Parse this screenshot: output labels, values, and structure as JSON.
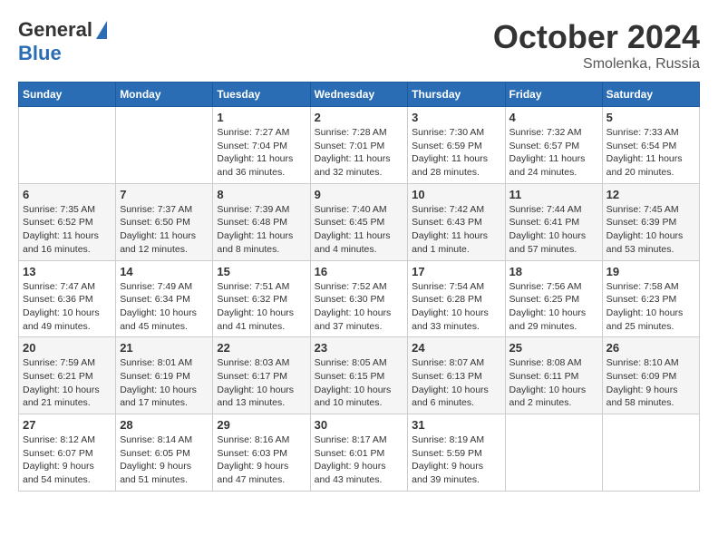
{
  "header": {
    "logo_general": "General",
    "logo_blue": "Blue",
    "month": "October 2024",
    "location": "Smolenka, Russia"
  },
  "weekdays": [
    "Sunday",
    "Monday",
    "Tuesday",
    "Wednesday",
    "Thursday",
    "Friday",
    "Saturday"
  ],
  "weeks": [
    [
      {
        "day": "",
        "info": ""
      },
      {
        "day": "",
        "info": ""
      },
      {
        "day": "1",
        "info": "Sunrise: 7:27 AM\nSunset: 7:04 PM\nDaylight: 11 hours and 36 minutes."
      },
      {
        "day": "2",
        "info": "Sunrise: 7:28 AM\nSunset: 7:01 PM\nDaylight: 11 hours and 32 minutes."
      },
      {
        "day": "3",
        "info": "Sunrise: 7:30 AM\nSunset: 6:59 PM\nDaylight: 11 hours and 28 minutes."
      },
      {
        "day": "4",
        "info": "Sunrise: 7:32 AM\nSunset: 6:57 PM\nDaylight: 11 hours and 24 minutes."
      },
      {
        "day": "5",
        "info": "Sunrise: 7:33 AM\nSunset: 6:54 PM\nDaylight: 11 hours and 20 minutes."
      }
    ],
    [
      {
        "day": "6",
        "info": "Sunrise: 7:35 AM\nSunset: 6:52 PM\nDaylight: 11 hours and 16 minutes."
      },
      {
        "day": "7",
        "info": "Sunrise: 7:37 AM\nSunset: 6:50 PM\nDaylight: 11 hours and 12 minutes."
      },
      {
        "day": "8",
        "info": "Sunrise: 7:39 AM\nSunset: 6:48 PM\nDaylight: 11 hours and 8 minutes."
      },
      {
        "day": "9",
        "info": "Sunrise: 7:40 AM\nSunset: 6:45 PM\nDaylight: 11 hours and 4 minutes."
      },
      {
        "day": "10",
        "info": "Sunrise: 7:42 AM\nSunset: 6:43 PM\nDaylight: 11 hours and 1 minute."
      },
      {
        "day": "11",
        "info": "Sunrise: 7:44 AM\nSunset: 6:41 PM\nDaylight: 10 hours and 57 minutes."
      },
      {
        "day": "12",
        "info": "Sunrise: 7:45 AM\nSunset: 6:39 PM\nDaylight: 10 hours and 53 minutes."
      }
    ],
    [
      {
        "day": "13",
        "info": "Sunrise: 7:47 AM\nSunset: 6:36 PM\nDaylight: 10 hours and 49 minutes."
      },
      {
        "day": "14",
        "info": "Sunrise: 7:49 AM\nSunset: 6:34 PM\nDaylight: 10 hours and 45 minutes."
      },
      {
        "day": "15",
        "info": "Sunrise: 7:51 AM\nSunset: 6:32 PM\nDaylight: 10 hours and 41 minutes."
      },
      {
        "day": "16",
        "info": "Sunrise: 7:52 AM\nSunset: 6:30 PM\nDaylight: 10 hours and 37 minutes."
      },
      {
        "day": "17",
        "info": "Sunrise: 7:54 AM\nSunset: 6:28 PM\nDaylight: 10 hours and 33 minutes."
      },
      {
        "day": "18",
        "info": "Sunrise: 7:56 AM\nSunset: 6:25 PM\nDaylight: 10 hours and 29 minutes."
      },
      {
        "day": "19",
        "info": "Sunrise: 7:58 AM\nSunset: 6:23 PM\nDaylight: 10 hours and 25 minutes."
      }
    ],
    [
      {
        "day": "20",
        "info": "Sunrise: 7:59 AM\nSunset: 6:21 PM\nDaylight: 10 hours and 21 minutes."
      },
      {
        "day": "21",
        "info": "Sunrise: 8:01 AM\nSunset: 6:19 PM\nDaylight: 10 hours and 17 minutes."
      },
      {
        "day": "22",
        "info": "Sunrise: 8:03 AM\nSunset: 6:17 PM\nDaylight: 10 hours and 13 minutes."
      },
      {
        "day": "23",
        "info": "Sunrise: 8:05 AM\nSunset: 6:15 PM\nDaylight: 10 hours and 10 minutes."
      },
      {
        "day": "24",
        "info": "Sunrise: 8:07 AM\nSunset: 6:13 PM\nDaylight: 10 hours and 6 minutes."
      },
      {
        "day": "25",
        "info": "Sunrise: 8:08 AM\nSunset: 6:11 PM\nDaylight: 10 hours and 2 minutes."
      },
      {
        "day": "26",
        "info": "Sunrise: 8:10 AM\nSunset: 6:09 PM\nDaylight: 9 hours and 58 minutes."
      }
    ],
    [
      {
        "day": "27",
        "info": "Sunrise: 8:12 AM\nSunset: 6:07 PM\nDaylight: 9 hours and 54 minutes."
      },
      {
        "day": "28",
        "info": "Sunrise: 8:14 AM\nSunset: 6:05 PM\nDaylight: 9 hours and 51 minutes."
      },
      {
        "day": "29",
        "info": "Sunrise: 8:16 AM\nSunset: 6:03 PM\nDaylight: 9 hours and 47 minutes."
      },
      {
        "day": "30",
        "info": "Sunrise: 8:17 AM\nSunset: 6:01 PM\nDaylight: 9 hours and 43 minutes."
      },
      {
        "day": "31",
        "info": "Sunrise: 8:19 AM\nSunset: 5:59 PM\nDaylight: 9 hours and 39 minutes."
      },
      {
        "day": "",
        "info": ""
      },
      {
        "day": "",
        "info": ""
      }
    ]
  ]
}
